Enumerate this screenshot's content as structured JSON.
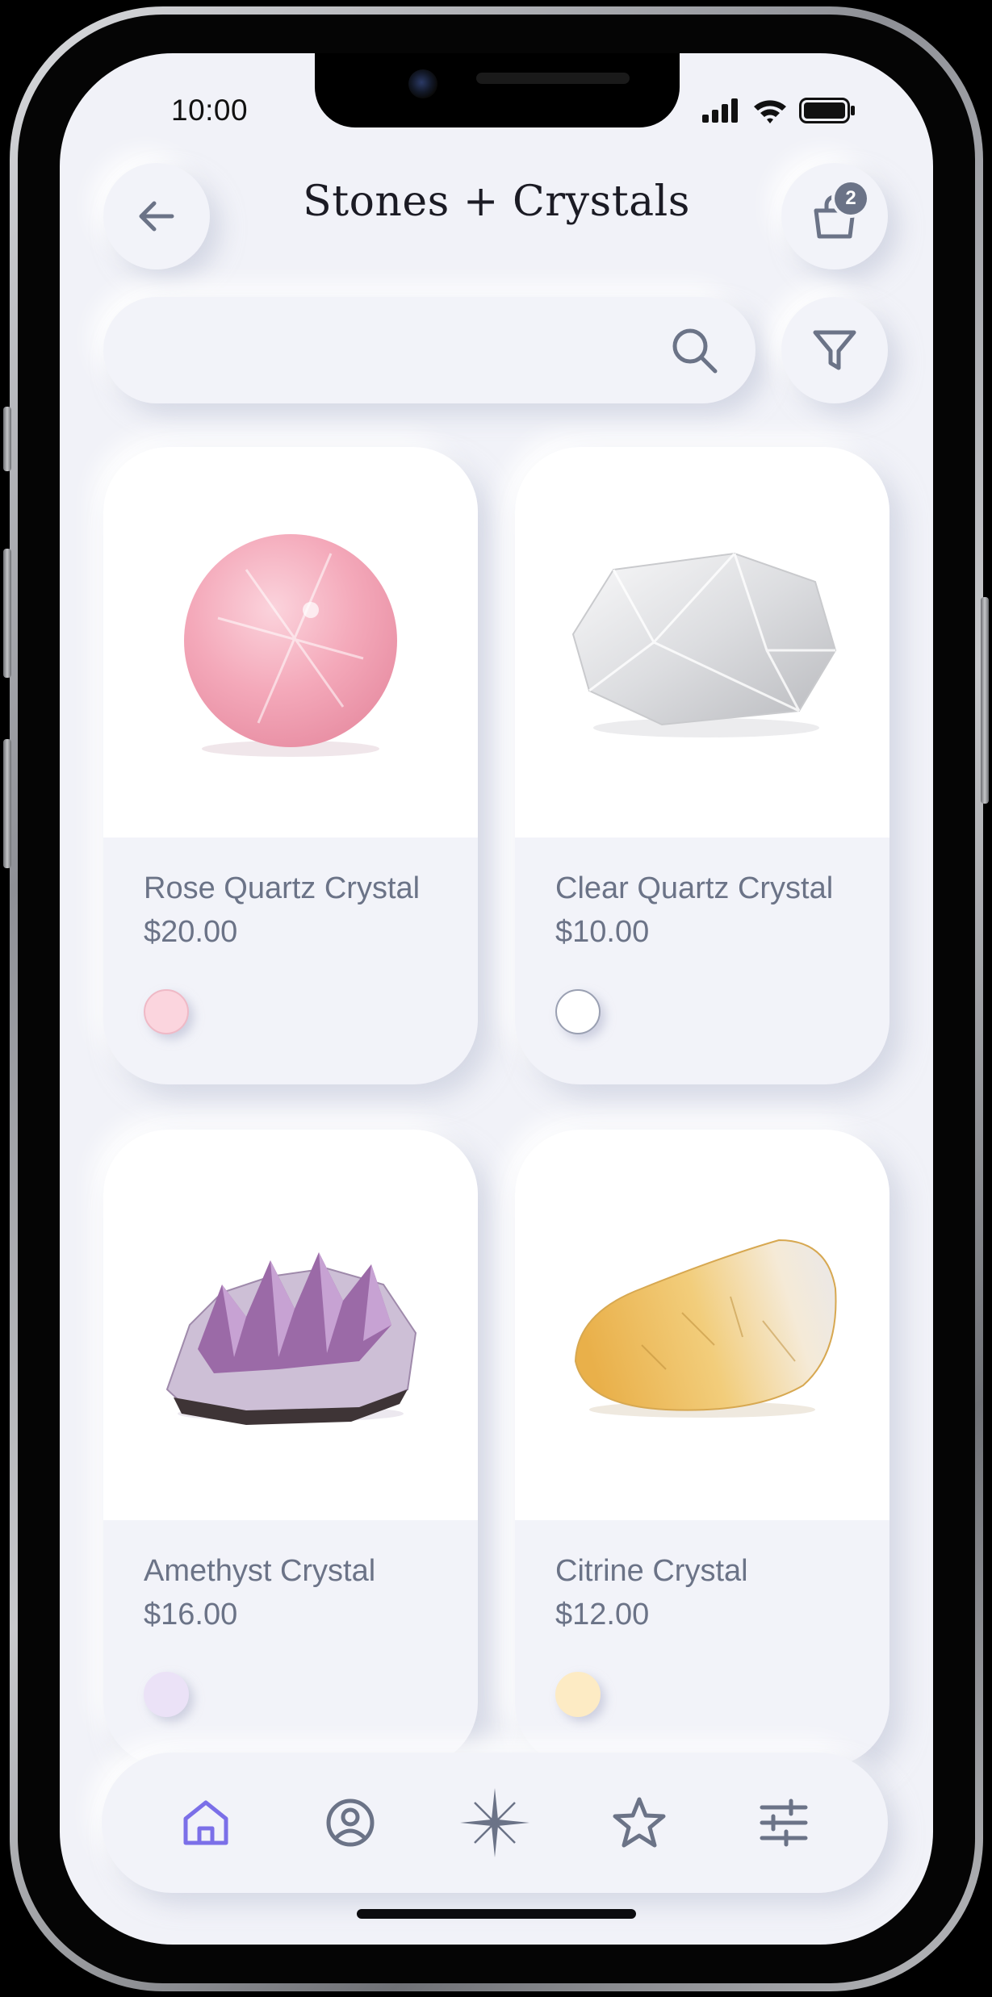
{
  "status_bar": {
    "time": "10:00",
    "icons": [
      "signal-icon",
      "wifi-icon",
      "battery-icon"
    ]
  },
  "header": {
    "title": "Stones + Crystals",
    "back_icon": "arrow-left-icon",
    "cart_icon": "shopping-bag-icon",
    "cart_count": "2"
  },
  "search": {
    "placeholder": "",
    "value": "",
    "icon": "search-icon",
    "filter_icon": "filter-icon"
  },
  "products": [
    {
      "name": "Rose Quartz Crystal",
      "price": "$20.00",
      "swatch": "#fbd5de"
    },
    {
      "name": "Clear Quartz Crystal",
      "price": "$10.00",
      "swatch": "#ffffff"
    },
    {
      "name": "Amethyst Crystal",
      "price": "$16.00",
      "swatch": "#ebe2f7"
    },
    {
      "name": "Citrine Crystal",
      "price": "$12.00",
      "swatch": "#fdebc4"
    }
  ],
  "tabbar": {
    "items": [
      "home-icon",
      "profile-icon",
      "sparkle-icon",
      "star-icon",
      "sliders-icon"
    ],
    "active": "home-icon"
  },
  "colors": {
    "background": "#f1f2f8",
    "text": "#6b7387",
    "title": "#1b1b24",
    "accent": "#7b6fe8"
  }
}
